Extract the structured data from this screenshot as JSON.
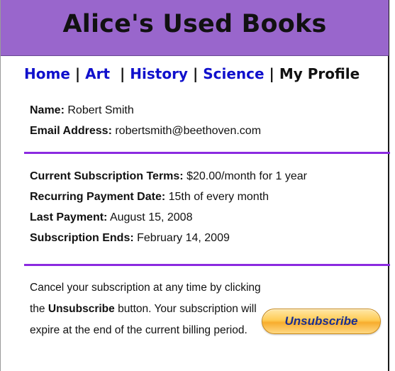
{
  "header": {
    "title": "Alice's Used Books"
  },
  "nav": {
    "home": "Home",
    "art": "Art",
    "history": "History",
    "science": "Science",
    "my_profile": "My Profile",
    "separator": "|"
  },
  "profile": {
    "name_label": "Name:",
    "name_value": "Robert Smith",
    "email_label": "Email Address:",
    "email_value": "robertsmith@beethoven.com"
  },
  "subscription": {
    "terms_label": "Current Subscription Terms:",
    "terms_value": "$20.00/month for 1 year",
    "recurring_label": "Recurring Payment Date:",
    "recurring_value": "15th of every month",
    "last_payment_label": "Last Payment:",
    "last_payment_value": "August 15, 2008",
    "ends_label": "Subscription Ends:",
    "ends_value": "February 14, 2009"
  },
  "cancel": {
    "text_before": "Cancel your subscription at any time by clicking the",
    "text_bold": "Unsubscribe",
    "text_after": "button. Your subscription will expire at the end of the current billing period.",
    "button_label": "Unsubscribe"
  },
  "colors": {
    "header_bg": "#9966cc",
    "divider": "#8b2ae0",
    "nav_link": "#1010cc",
    "button_text": "#1a2f8f",
    "button_bg": "#ffcc55"
  }
}
